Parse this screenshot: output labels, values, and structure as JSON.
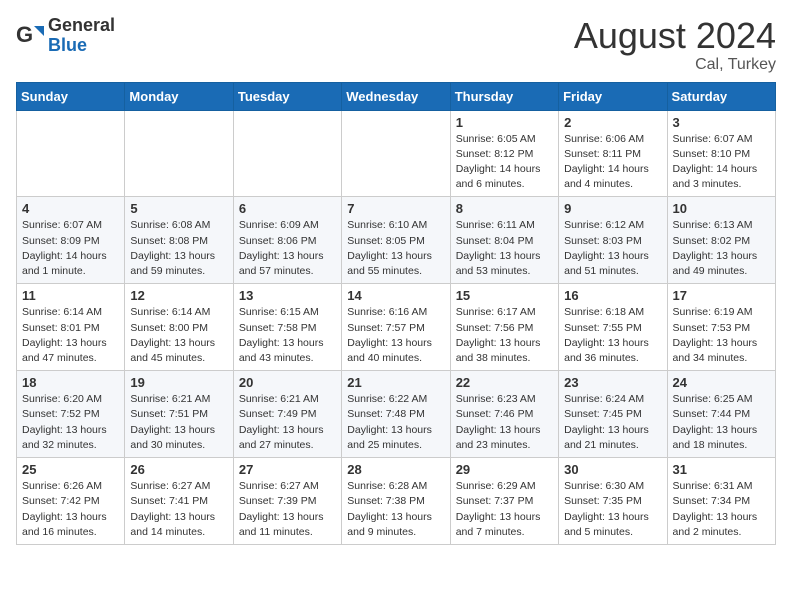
{
  "logo": {
    "general": "General",
    "blue": "Blue"
  },
  "title": {
    "month_year": "August 2024",
    "location": "Cal, Turkey"
  },
  "days_of_week": [
    "Sunday",
    "Monday",
    "Tuesday",
    "Wednesday",
    "Thursday",
    "Friday",
    "Saturday"
  ],
  "weeks": [
    [
      {
        "day": "",
        "info": ""
      },
      {
        "day": "",
        "info": ""
      },
      {
        "day": "",
        "info": ""
      },
      {
        "day": "",
        "info": ""
      },
      {
        "day": "1",
        "info": "Sunrise: 6:05 AM\nSunset: 8:12 PM\nDaylight: 14 hours\nand 6 minutes."
      },
      {
        "day": "2",
        "info": "Sunrise: 6:06 AM\nSunset: 8:11 PM\nDaylight: 14 hours\nand 4 minutes."
      },
      {
        "day": "3",
        "info": "Sunrise: 6:07 AM\nSunset: 8:10 PM\nDaylight: 14 hours\nand 3 minutes."
      }
    ],
    [
      {
        "day": "4",
        "info": "Sunrise: 6:07 AM\nSunset: 8:09 PM\nDaylight: 14 hours\nand 1 minute."
      },
      {
        "day": "5",
        "info": "Sunrise: 6:08 AM\nSunset: 8:08 PM\nDaylight: 13 hours\nand 59 minutes."
      },
      {
        "day": "6",
        "info": "Sunrise: 6:09 AM\nSunset: 8:06 PM\nDaylight: 13 hours\nand 57 minutes."
      },
      {
        "day": "7",
        "info": "Sunrise: 6:10 AM\nSunset: 8:05 PM\nDaylight: 13 hours\nand 55 minutes."
      },
      {
        "day": "8",
        "info": "Sunrise: 6:11 AM\nSunset: 8:04 PM\nDaylight: 13 hours\nand 53 minutes."
      },
      {
        "day": "9",
        "info": "Sunrise: 6:12 AM\nSunset: 8:03 PM\nDaylight: 13 hours\nand 51 minutes."
      },
      {
        "day": "10",
        "info": "Sunrise: 6:13 AM\nSunset: 8:02 PM\nDaylight: 13 hours\nand 49 minutes."
      }
    ],
    [
      {
        "day": "11",
        "info": "Sunrise: 6:14 AM\nSunset: 8:01 PM\nDaylight: 13 hours\nand 47 minutes."
      },
      {
        "day": "12",
        "info": "Sunrise: 6:14 AM\nSunset: 8:00 PM\nDaylight: 13 hours\nand 45 minutes."
      },
      {
        "day": "13",
        "info": "Sunrise: 6:15 AM\nSunset: 7:58 PM\nDaylight: 13 hours\nand 43 minutes."
      },
      {
        "day": "14",
        "info": "Sunrise: 6:16 AM\nSunset: 7:57 PM\nDaylight: 13 hours\nand 40 minutes."
      },
      {
        "day": "15",
        "info": "Sunrise: 6:17 AM\nSunset: 7:56 PM\nDaylight: 13 hours\nand 38 minutes."
      },
      {
        "day": "16",
        "info": "Sunrise: 6:18 AM\nSunset: 7:55 PM\nDaylight: 13 hours\nand 36 minutes."
      },
      {
        "day": "17",
        "info": "Sunrise: 6:19 AM\nSunset: 7:53 PM\nDaylight: 13 hours\nand 34 minutes."
      }
    ],
    [
      {
        "day": "18",
        "info": "Sunrise: 6:20 AM\nSunset: 7:52 PM\nDaylight: 13 hours\nand 32 minutes."
      },
      {
        "day": "19",
        "info": "Sunrise: 6:21 AM\nSunset: 7:51 PM\nDaylight: 13 hours\nand 30 minutes."
      },
      {
        "day": "20",
        "info": "Sunrise: 6:21 AM\nSunset: 7:49 PM\nDaylight: 13 hours\nand 27 minutes."
      },
      {
        "day": "21",
        "info": "Sunrise: 6:22 AM\nSunset: 7:48 PM\nDaylight: 13 hours\nand 25 minutes."
      },
      {
        "day": "22",
        "info": "Sunrise: 6:23 AM\nSunset: 7:46 PM\nDaylight: 13 hours\nand 23 minutes."
      },
      {
        "day": "23",
        "info": "Sunrise: 6:24 AM\nSunset: 7:45 PM\nDaylight: 13 hours\nand 21 minutes."
      },
      {
        "day": "24",
        "info": "Sunrise: 6:25 AM\nSunset: 7:44 PM\nDaylight: 13 hours\nand 18 minutes."
      }
    ],
    [
      {
        "day": "25",
        "info": "Sunrise: 6:26 AM\nSunset: 7:42 PM\nDaylight: 13 hours\nand 16 minutes."
      },
      {
        "day": "26",
        "info": "Sunrise: 6:27 AM\nSunset: 7:41 PM\nDaylight: 13 hours\nand 14 minutes."
      },
      {
        "day": "27",
        "info": "Sunrise: 6:27 AM\nSunset: 7:39 PM\nDaylight: 13 hours\nand 11 minutes."
      },
      {
        "day": "28",
        "info": "Sunrise: 6:28 AM\nSunset: 7:38 PM\nDaylight: 13 hours\nand 9 minutes."
      },
      {
        "day": "29",
        "info": "Sunrise: 6:29 AM\nSunset: 7:37 PM\nDaylight: 13 hours\nand 7 minutes."
      },
      {
        "day": "30",
        "info": "Sunrise: 6:30 AM\nSunset: 7:35 PM\nDaylight: 13 hours\nand 5 minutes."
      },
      {
        "day": "31",
        "info": "Sunrise: 6:31 AM\nSunset: 7:34 PM\nDaylight: 13 hours\nand 2 minutes."
      }
    ]
  ]
}
